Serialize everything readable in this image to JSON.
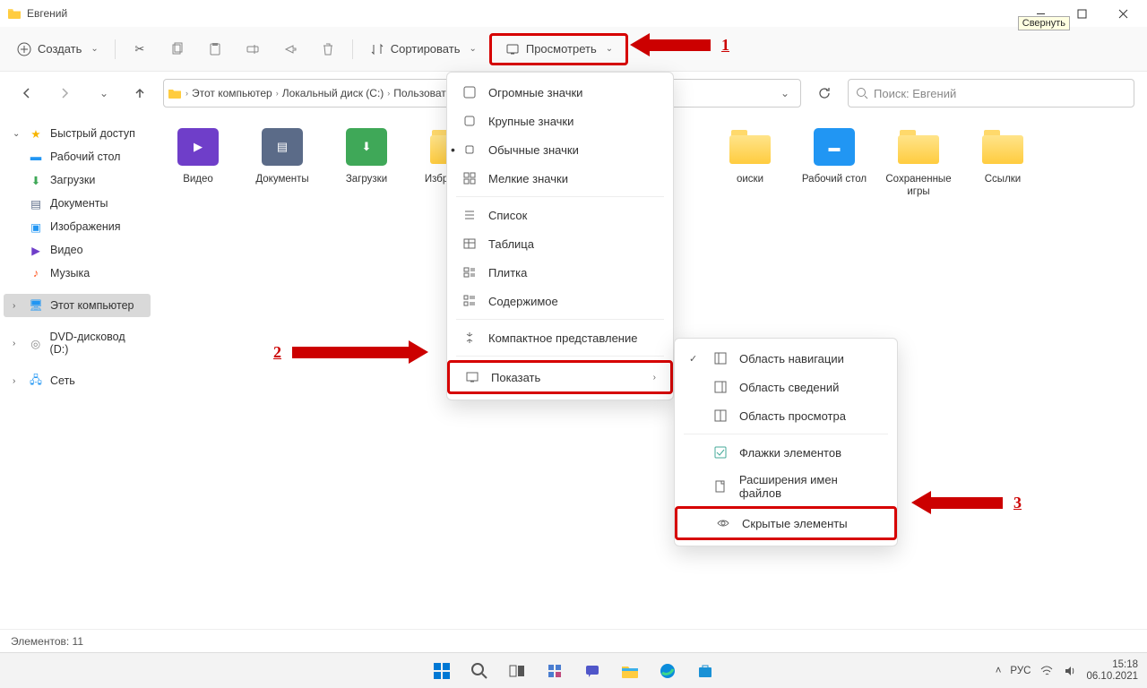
{
  "title": "Евгений",
  "win_tooltip": "Свернуть",
  "toolbar": {
    "create": "Создать",
    "sort": "Сортировать",
    "view": "Просмотреть"
  },
  "breadcrumb": [
    "Этот компьютер",
    "Локальный диск (C:)",
    "Пользоват"
  ],
  "search_placeholder": "Поиск: Евгений",
  "sidebar": {
    "quick": "Быстрый доступ",
    "desktop": "Рабочий стол",
    "downloads": "Загрузки",
    "documents": "Документы",
    "images": "Изображения",
    "videos": "Видео",
    "music": "Музыка",
    "thispc": "Этот компьютер",
    "dvd": "DVD-дисковод (D:)",
    "network": "Сеть"
  },
  "items": [
    {
      "label": "Видео",
      "type": "video"
    },
    {
      "label": "Документы",
      "type": "docs"
    },
    {
      "label": "Загрузки",
      "type": "downloads"
    },
    {
      "label": "Избранное",
      "type": "folder"
    },
    {
      "label": "оиски",
      "type": "folder"
    },
    {
      "label": "Рабочий стол",
      "type": "desktop"
    },
    {
      "label": "Сохраненные игры",
      "type": "folder"
    },
    {
      "label": "Ссылки",
      "type": "folder"
    }
  ],
  "view_menu": [
    {
      "icon": "xl",
      "label": "Огромные значки"
    },
    {
      "icon": "lg",
      "label": "Крупные значки"
    },
    {
      "icon": "md",
      "label": "Обычные значки",
      "active": true
    },
    {
      "icon": "sm",
      "label": "Мелкие значки"
    },
    {
      "sep": true
    },
    {
      "icon": "list",
      "label": "Список"
    },
    {
      "icon": "table",
      "label": "Таблица"
    },
    {
      "icon": "tiles",
      "label": "Плитка"
    },
    {
      "icon": "content",
      "label": "Содержимое"
    },
    {
      "sep": true
    },
    {
      "icon": "compact",
      "label": "Компактное представление"
    },
    {
      "sep": true
    },
    {
      "icon": "show",
      "label": "Показать",
      "expand": true,
      "highlight": true
    }
  ],
  "show_menu": [
    {
      "checked": true,
      "icon": "nav",
      "label": "Область навигации"
    },
    {
      "icon": "details",
      "label": "Область сведений"
    },
    {
      "icon": "preview",
      "label": "Область просмотра"
    },
    {
      "sep": true
    },
    {
      "icon": "checkboxes",
      "label": "Флажки элементов"
    },
    {
      "icon": "ext",
      "label": "Расширения имен файлов"
    },
    {
      "icon": "hidden",
      "label": "Скрытые элементы",
      "highlight": true
    }
  ],
  "status": "Элементов: 11",
  "annotations": {
    "one": "1",
    "two": "2",
    "three": "3"
  },
  "tray": {
    "lang": "РУС",
    "time": "15:18",
    "date": "06.10.2021"
  }
}
